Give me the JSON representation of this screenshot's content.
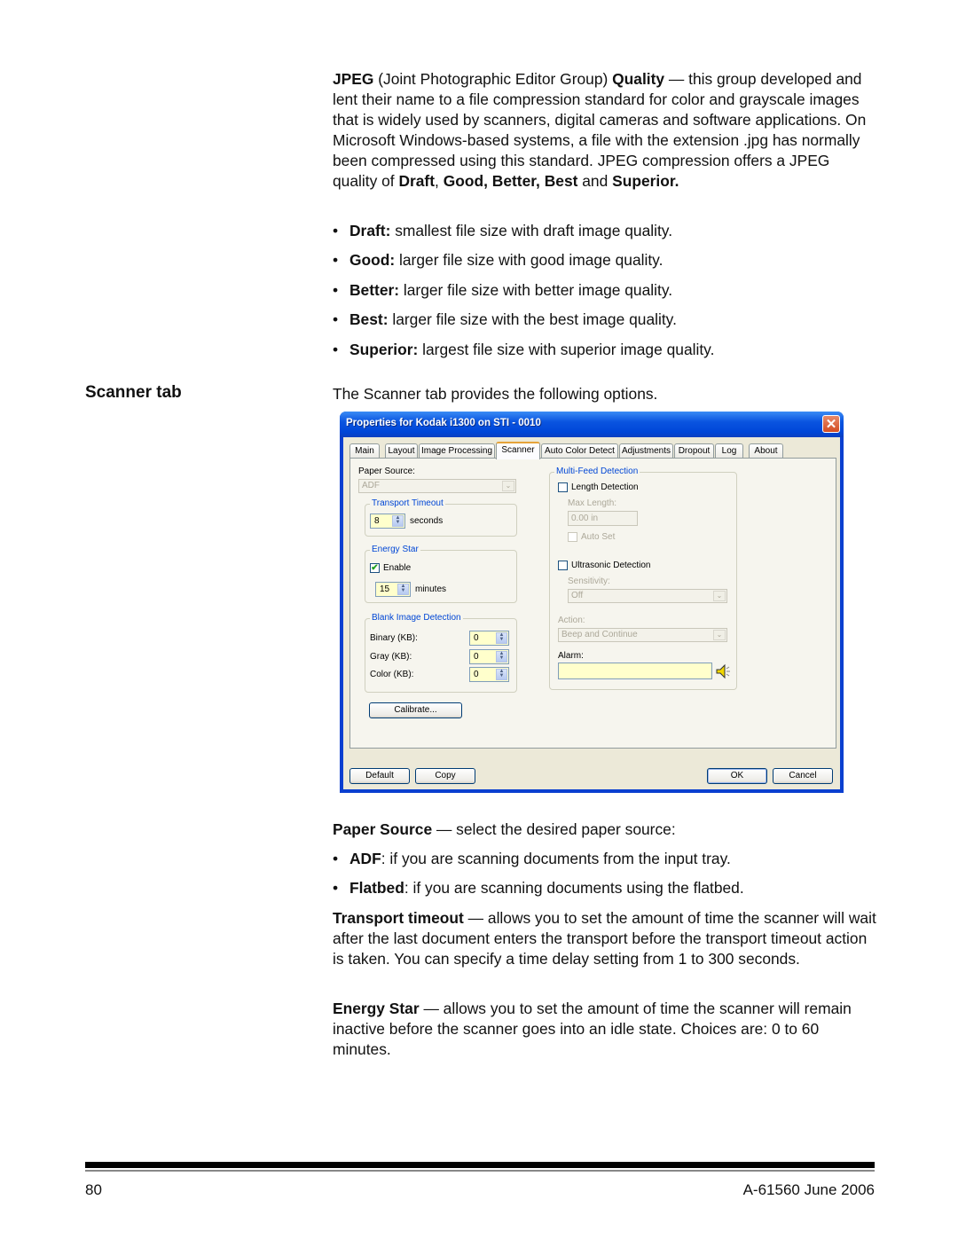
{
  "intro": {
    "term1": "JPEG",
    "text1": " (Joint Photographic Editor Group) ",
    "term2": "Quality",
    "text2": " — this group developed and lent their name to a file compression standard for color and grayscale images that is widely used by scanners, digital cameras and software applications. On Microsoft Windows-based systems, a file with the extension .jpg has normally been compressed using this standard. JPEG compression offers a JPEG quality of ",
    "q1": "Draft",
    "sep1": ", ",
    "q2": "Good, Better, Best",
    "sep2": " and ",
    "q3": "Superior."
  },
  "quality_bullets": [
    {
      "term": "Draft:",
      "text": " smallest file size with draft image quality."
    },
    {
      "term": "Good:",
      "text": " larger file size with good image quality."
    },
    {
      "term": "Better:",
      "text": " larger file size with better image quality."
    },
    {
      "term": "Best:",
      "text": " larger file size with the best image quality."
    },
    {
      "term": "Superior:",
      "text": " largest file size with superior image quality."
    }
  ],
  "bullet_char": "•",
  "section_heading": "Scanner tab",
  "section_intro": "The Scanner tab provides the following options.",
  "dialog": {
    "title": "Properties for Kodak i1300 on STI - 0010",
    "close_glyph": "✕",
    "tabs": [
      "Main",
      "Layout",
      "Image Processing",
      "Scanner",
      "Auto Color Detect",
      "Adjustments",
      "Dropout",
      "Log",
      "About"
    ],
    "active_tab": "Scanner",
    "paper_source": {
      "label": "Paper Source:",
      "value": "ADF"
    },
    "transport_timeout": {
      "title": "Transport Timeout",
      "value": "8",
      "unit": "seconds"
    },
    "energy_star": {
      "title": "Energy Star",
      "enable_label": "Enable",
      "enabled": true,
      "value": "15",
      "unit": "minutes"
    },
    "blank_image": {
      "title": "Blank Image Detection",
      "rows": [
        {
          "label": "Binary (KB):",
          "value": "0"
        },
        {
          "label": "Gray (KB):",
          "value": "0"
        },
        {
          "label": "Color (KB):",
          "value": "0"
        }
      ]
    },
    "calibrate_label": "Calibrate...",
    "multifeed": {
      "title": "Multi-Feed Detection",
      "length_detection_label": "Length Detection",
      "max_length_label": "Max Length:",
      "max_length_value": "0.00 in",
      "auto_set_label": "Auto Set",
      "ultrasonic_label": "Ultrasonic Detection",
      "sensitivity_label": "Sensitivity:",
      "sensitivity_value": "Off",
      "action_label": "Action:",
      "action_value": "Beep and Continue",
      "alarm_label": "Alarm:",
      "alarm_value": ""
    },
    "buttons": {
      "default": "Default",
      "copy": "Copy",
      "ok": "OK",
      "cancel": "Cancel"
    },
    "check_glyph": "✔",
    "arrow_glyph": "⌄",
    "spin_glyph": "▲▼"
  },
  "paper_source_desc": {
    "term": "Paper Source",
    "text": " — select the desired paper source:"
  },
  "paper_bullets": [
    {
      "term": "ADF",
      "text": ": if you are scanning documents from the input tray."
    },
    {
      "term": "Flatbed",
      "text": ": if you are scanning documents using the flatbed."
    }
  ],
  "transport_desc": {
    "term": "Transport timeout",
    "text": " — allows you to set the amount of time the scanner will wait after the last document enters the transport before the transport timeout action is taken. You can specify a time delay setting from 1 to 300 seconds."
  },
  "energy_desc": {
    "term": "Energy Star",
    "text": " — allows you to set the amount of time the scanner will remain inactive before the scanner goes into an idle state. Choices are: 0 to 60 minutes."
  },
  "footer": {
    "page_number": "80",
    "doc_id": "A-61560  June 2006"
  }
}
